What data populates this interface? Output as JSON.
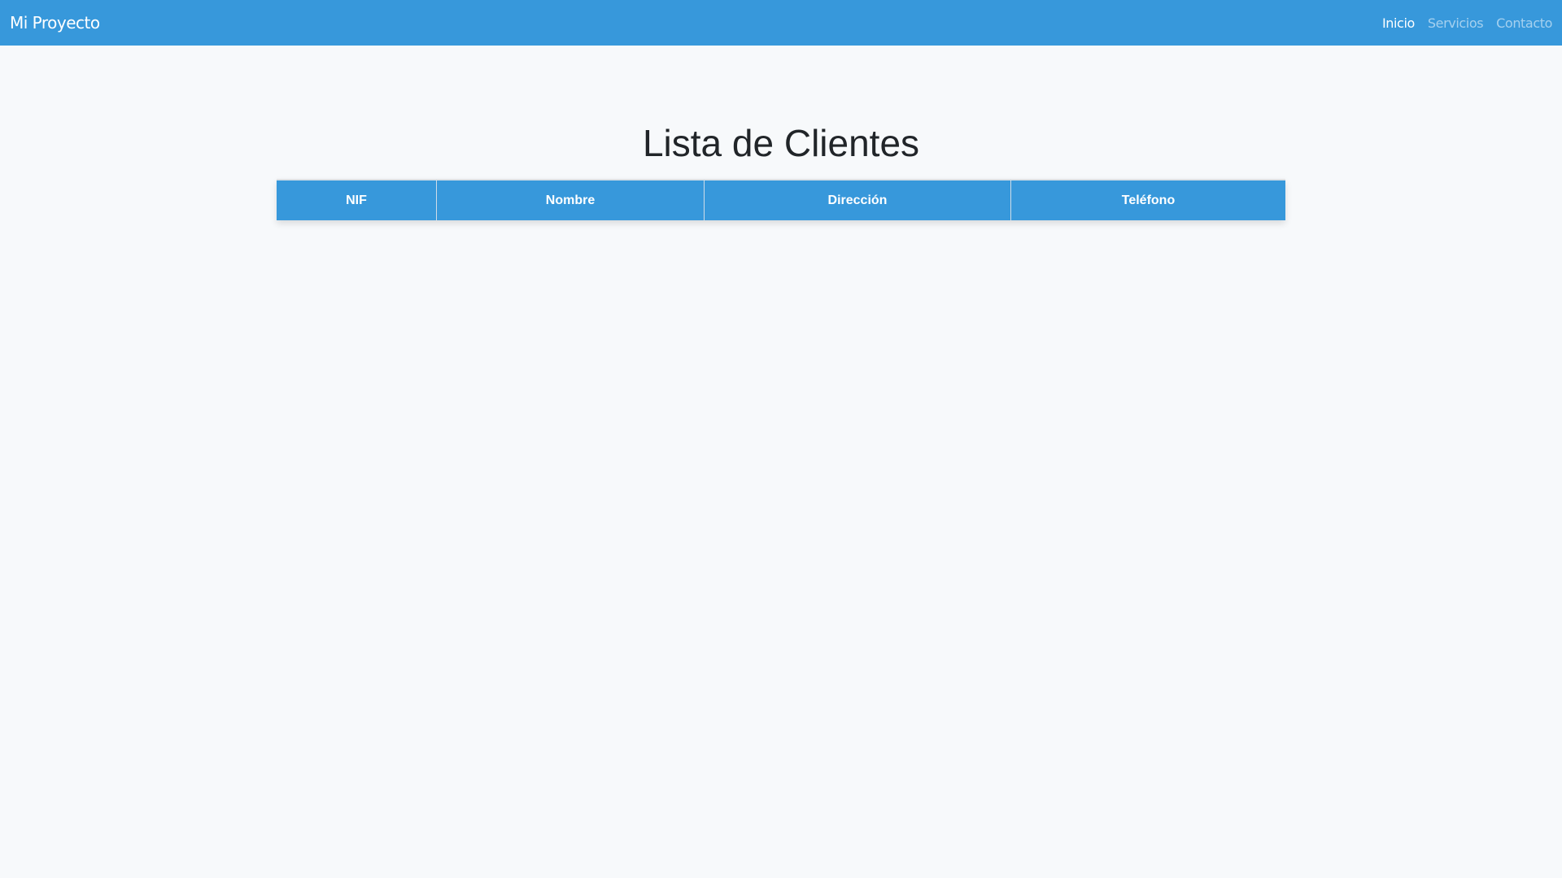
{
  "navbar": {
    "brand": "Mi Proyecto",
    "links": [
      {
        "label": "Inicio",
        "active": true
      },
      {
        "label": "Servicios",
        "active": false
      },
      {
        "label": "Contacto",
        "active": false
      }
    ]
  },
  "main": {
    "title": "Lista de Clientes",
    "table": {
      "columns": [
        "NIF",
        "Nombre",
        "Dirección",
        "Teléfono"
      ],
      "rows": []
    }
  },
  "colors": {
    "primary": "#3798db",
    "background": "#f7f9fb"
  }
}
